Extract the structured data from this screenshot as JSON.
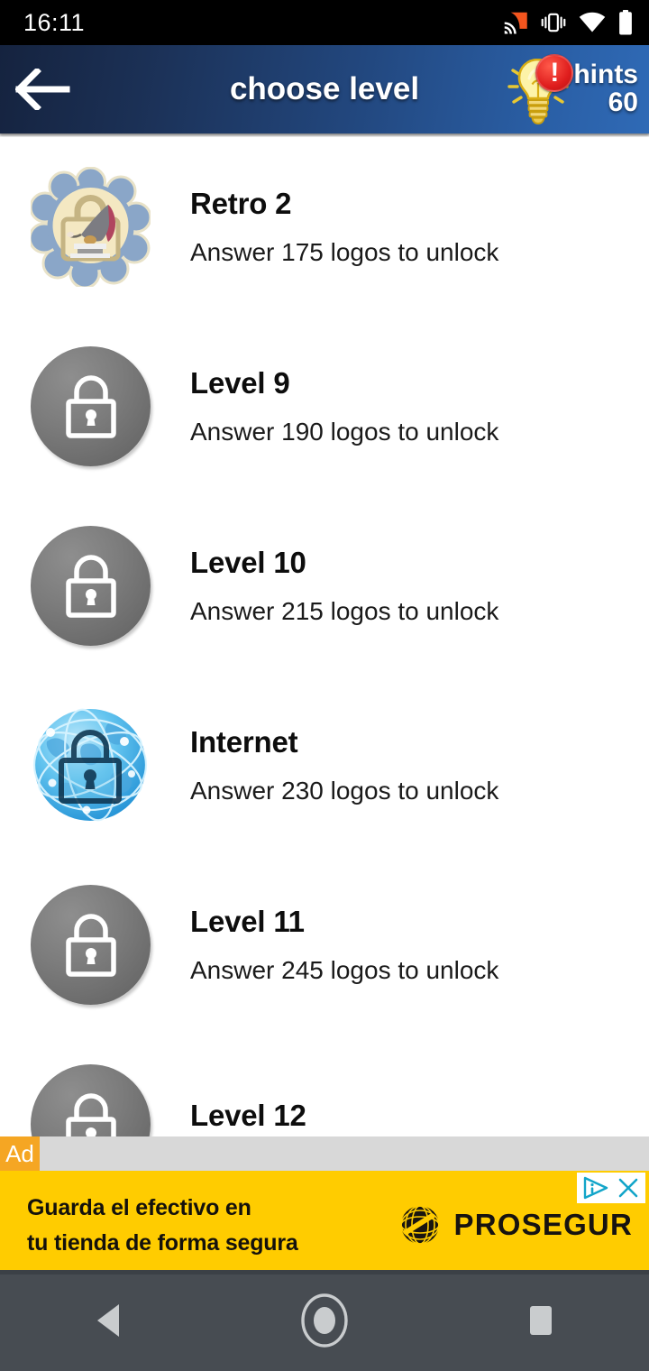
{
  "statusbar": {
    "time": "16:11",
    "icons": [
      "cast-icon",
      "vibrate-icon",
      "wifi-icon",
      "battery-icon"
    ]
  },
  "header": {
    "title": "choose level",
    "back_icon": "back-arrow-icon",
    "hints": {
      "icon": "lightbulb-icon",
      "badge": "!",
      "label": "hints",
      "count": "60"
    },
    "gradient_from": "#15233f",
    "gradient_to": "#2f6ab6"
  },
  "levels": [
    {
      "title": "Retro 2",
      "subtitle": "Answer 175 logos to unlock",
      "icon": "retro-badge-gramophone-lock-icon",
      "state": "locked-special"
    },
    {
      "title": "Level 9",
      "subtitle": "Answer 190 logos to unlock",
      "icon": "lock-circle-icon",
      "state": "locked"
    },
    {
      "title": "Level 10",
      "subtitle": "Answer 215 logos to unlock",
      "icon": "lock-circle-icon",
      "state": "locked"
    },
    {
      "title": "Internet",
      "subtitle": "Answer 230 logos to unlock",
      "icon": "globe-lock-icon",
      "state": "locked-special"
    },
    {
      "title": "Level 11",
      "subtitle": "Answer 245 logos to unlock",
      "icon": "lock-circle-icon",
      "state": "locked"
    },
    {
      "title": "Level 12",
      "subtitle": "",
      "icon": "lock-circle-icon",
      "state": "locked"
    }
  ],
  "ad": {
    "badge": "Ad",
    "copy_line1": "Guarda el efectivo en",
    "copy_line2": "tu tienda de forma segura",
    "brand": "PROSEGUR",
    "brand_icon": "prosegur-globe-icon",
    "adchoices_icon": "adchoices-icon",
    "close_icon": "close-icon",
    "background": "#ffcc00"
  },
  "navbar": {
    "back": "nav-back-icon",
    "home": "nav-home-icon",
    "recents": "nav-recents-icon"
  }
}
